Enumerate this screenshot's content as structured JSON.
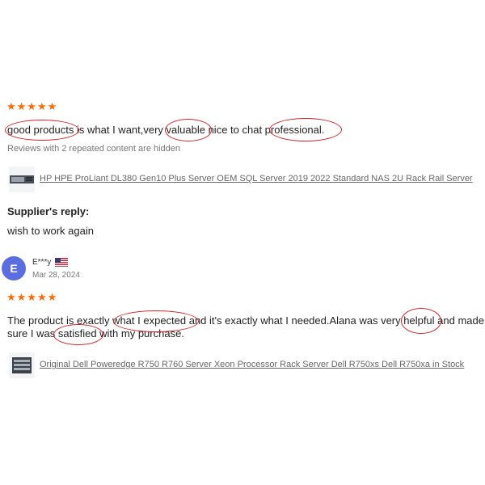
{
  "review1": {
    "rating": 5,
    "stars": "★★★★★",
    "text": "good products is what I want,very valuable nice to chat professional.",
    "hidden_note": "Reviews with 2 repeated content are hidden",
    "product_name": "HP HPE ProLiant DL380 Gen10 Plus Server OEM SQL Server 2019 2022 Standard NAS 2U Rack Rail Server",
    "supplier_reply_label": "Supplier's reply:",
    "supplier_reply_text": "wish to work again"
  },
  "review2": {
    "avatar_letter": "E",
    "reviewer": "E***y",
    "country_flag_icon": "us-flag-icon",
    "date": "Mar 28, 2024",
    "rating": 5,
    "stars": "★★★★★",
    "text_line1": "The product is exactly what I expected and it's exactly what I needed.Alana was very helpful and made",
    "text_line2": "sure I was satisfied with my purchase.",
    "product_name": "Original Dell Poweredge R750 R760 Server Xeon Processor Rack Server Dell R750xs Dell R750xa in Stock"
  },
  "colors": {
    "star": "#ff6a00",
    "annotation_oval": "#d2232a",
    "avatar_bg": "#5b6ee1"
  }
}
